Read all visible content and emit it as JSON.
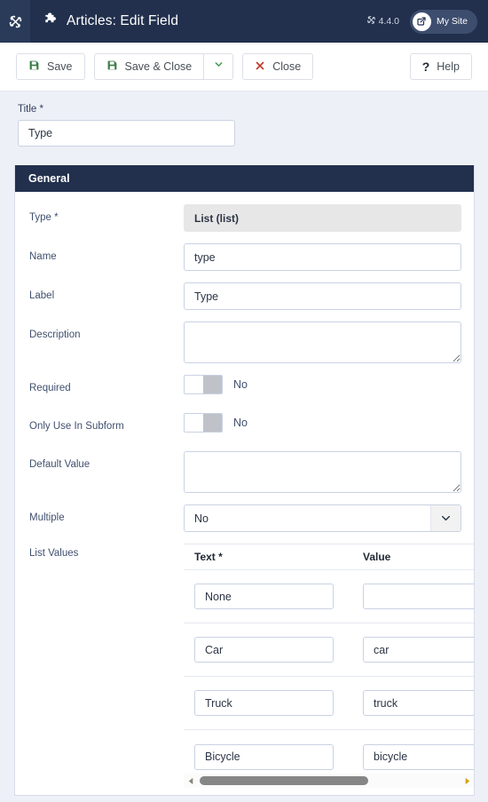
{
  "header": {
    "logo_icon": "joomla-logo-icon",
    "page_icon": "puzzle-piece-icon",
    "title": "Articles: Edit Field",
    "version": "4.4.0",
    "version_icon": "joomla-mark-icon",
    "site_link_label": "My Site",
    "site_link_icon": "external-link-icon"
  },
  "toolbar": {
    "save_label": "Save",
    "save_icon": "floppy-disk-icon",
    "save_close_label": "Save & Close",
    "save_close_icon": "floppy-disk-icon",
    "dropdown_icon": "chevron-down-icon",
    "close_label": "Close",
    "close_icon": "x-icon",
    "help_label": "Help",
    "help_icon": "question-mark-icon"
  },
  "title_field": {
    "label": "Title *",
    "value": "Type",
    "placeholder": ""
  },
  "panel": {
    "tab_label": "General"
  },
  "fields": {
    "type": {
      "label": "Type *",
      "value": "List (list)"
    },
    "name": {
      "label": "Name",
      "value": "type",
      "placeholder": ""
    },
    "field_label": {
      "label": "Label",
      "value": "Type",
      "placeholder": ""
    },
    "description": {
      "label": "Description",
      "value": "",
      "placeholder": ""
    },
    "required": {
      "label": "Required",
      "state": "No"
    },
    "only_use_in_subform": {
      "label": "Only Use In Subform",
      "state": "No"
    },
    "default_value": {
      "label": "Default Value",
      "value": "",
      "placeholder": ""
    },
    "multiple": {
      "label": "Multiple",
      "value": "No",
      "icon": "chevron-down-icon"
    }
  },
  "list_values": {
    "label": "List Values",
    "columns": [
      "Text *",
      "Value"
    ],
    "rows": [
      {
        "text": "None",
        "value": ""
      },
      {
        "text": "Car",
        "value": "car"
      },
      {
        "text": "Truck",
        "value": "truck"
      },
      {
        "text": "Bicycle",
        "value": "bicycle"
      }
    ]
  },
  "scrollbar": {
    "left_icon": "triangle-left-icon",
    "right_icon": "triangle-right-icon"
  },
  "colors": {
    "header_bg": "#22304d",
    "page_bg": "#eef0f7",
    "accent_green": "#3a7d44",
    "accent_red": "#c0392b",
    "panel_head_bg": "#22304d"
  }
}
